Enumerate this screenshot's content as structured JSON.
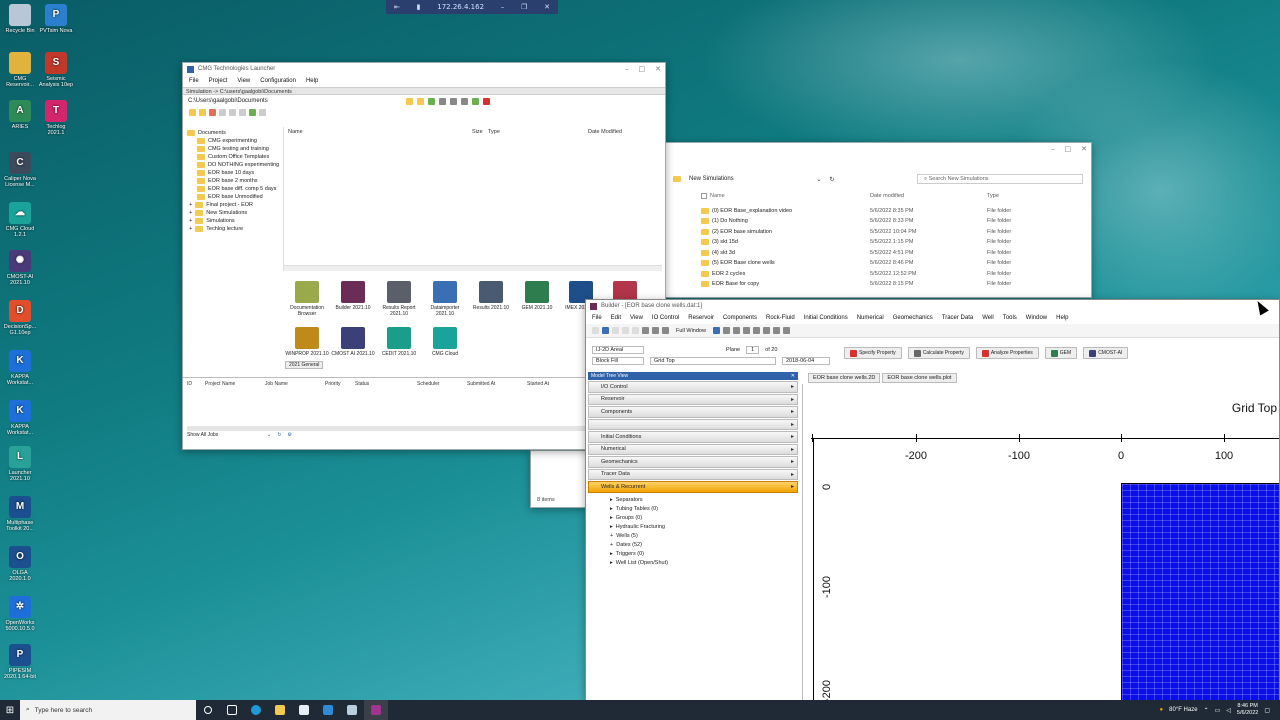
{
  "rdp_bar": {
    "ip": "172.26.4.162"
  },
  "desktop_icons": [
    {
      "label": "Recycle Bin",
      "color": "#b9c6d6"
    },
    {
      "label": "PVTsim Nova",
      "color": "#2c7fcf"
    },
    {
      "label": "CMG Reservoir...",
      "color": "#e2b33c"
    },
    {
      "label": "Seismic Analysis 10ep",
      "color": "#c0392b"
    },
    {
      "label": "ARIES",
      "color": "#2e8b57"
    },
    {
      "label": "Techlog 2021.1",
      "color": "#d3256b"
    },
    {
      "label": "Caliper Nova License M...",
      "color": "#3d4a5c"
    },
    {
      "label": "CMG Cloud 1.2.1",
      "color": "#1aa39a"
    },
    {
      "label": "CMOST-AI 2021.10",
      "color": "#4b3a7a"
    },
    {
      "label": "DecisionSp... G1.10ep",
      "color": "#e04e2b"
    },
    {
      "label": "KAPPA Workstat...",
      "color": "#1e6fd9"
    },
    {
      "label": "KAPPA Workstat...",
      "color": "#1e6fd9"
    },
    {
      "label": "Launcher 2021.10",
      "color": "#2aa198"
    },
    {
      "label": "Multiphase Toolkit 20...",
      "color": "#1b4f8f"
    },
    {
      "label": "OLGA 2020.1.0",
      "color": "#1b4f8f"
    },
    {
      "label": "OpenWorks 5000.10.5.0",
      "color": "#1e6fd9"
    },
    {
      "label": "PIPESIM 2020.1 64-bit",
      "color": "#1b4f8f"
    }
  ],
  "launcher": {
    "title": "CMG Technologies Launcher",
    "menu": [
      "File",
      "Project",
      "View",
      "Configuration",
      "Help"
    ],
    "simulation_path": "Simulation -> C:\\users\\gaalgobi\\Documents",
    "current_path": "C:\\Users\\gaalgobi\\Documents",
    "tree": [
      "Documents",
      "CMG experimenting",
      "CMG testing and training",
      "Custom Office Templates",
      "DO NOTHING experimenting",
      "EOR base 10 days",
      "EOR base 2 months",
      "EOR base diff. comp 5 days",
      "EOR base Unmodified",
      "Final project - EOR",
      "New Simulations",
      "Simulations",
      "Techlog lecture"
    ],
    "file_columns": [
      "Name",
      "Size",
      "Type",
      "Date Modified"
    ],
    "apps": [
      {
        "label": "Documentation Browser",
        "color": "#9aa94a"
      },
      {
        "label": "Builder 2021.10",
        "color": "#6b2d57"
      },
      {
        "label": "Results Report 2021.10",
        "color": "#5b5f6a"
      },
      {
        "label": "Dataimporter 2021.10",
        "color": "#3a6fb5"
      },
      {
        "label": "Results 2021.10",
        "color": "#4a5a70"
      },
      {
        "label": "GEM 2021.10",
        "color": "#2e7d4f"
      },
      {
        "label": "IMEX 2021.10",
        "color": "#1f4f8a"
      },
      {
        "label": "",
        "color": "#b2354a"
      },
      {
        "label": "WINPROP 2021.10",
        "color": "#c08a1a"
      },
      {
        "label": "CMOST AI 2021.10",
        "color": "#3b3f7a"
      },
      {
        "label": "CEDIT 2021.10",
        "color": "#1a9e8a"
      },
      {
        "label": "CMG Cloud",
        "color": "#1aa39a"
      }
    ],
    "apps_tab": "2021 General",
    "job_columns": [
      "ID",
      "Project Name",
      "Job Name",
      "Priority",
      "Status",
      "Scheduler",
      "Submitted At",
      "Started At"
    ],
    "jobs_filter": "Show All Jobs"
  },
  "explorer": {
    "breadcrumb": "New Simulations",
    "search_placeholder": "Search New Simulations",
    "columns": [
      "Name",
      "Date modified",
      "Type"
    ],
    "rows": [
      {
        "name": "(0) EOR Base_explanation video",
        "date": "5/6/2022 8:35 PM",
        "type": "File folder"
      },
      {
        "name": "(1) Do Nothing",
        "date": "5/6/2022 8:33 PM",
        "type": "File folder"
      },
      {
        "name": "(2) EOR base simulation",
        "date": "5/5/2022 10:04 PM",
        "type": "File folder"
      },
      {
        "name": "(3) skt 15d",
        "date": "5/5/2022 1:15 PM",
        "type": "File folder"
      },
      {
        "name": "(4) skt 3d",
        "date": "5/5/2022 4:51 PM",
        "type": "File folder"
      },
      {
        "name": "(5) EOR Base clone wells",
        "date": "5/6/2022 8:46 PM",
        "type": "File folder"
      },
      {
        "name": "EOR 2 cycles",
        "date": "5/5/2022 12:52 PM",
        "type": "File folder"
      },
      {
        "name": "EOR Base for copy",
        "date": "5/6/2022 8:15 PM",
        "type": "File folder"
      }
    ],
    "status": "8 items"
  },
  "builder": {
    "title": "Builder - [EOR base clone wells.dat:1]",
    "menu": [
      "File",
      "Edit",
      "View",
      "IO Control",
      "Reservoir",
      "Components",
      "Rock-Fluid",
      "Initial Conditions",
      "Numerical",
      "Geomechanics",
      "Tracer Data",
      "Well",
      "Tools",
      "Window",
      "Help"
    ],
    "full_window": "Full Window",
    "view_mode": "IJ-2D Areal",
    "plane_label": "Plane",
    "plane_value": "1",
    "plane_of": "of 20",
    "fill_mode": "Block Fill",
    "property": "Grid Top",
    "date": "2018-06-04",
    "buttons": [
      "Specify Property",
      "Calculate Property",
      "Analyze Properties",
      "GEM",
      "CMOST-AI"
    ],
    "model_tree_title": "Model Tree View",
    "sections": [
      "I/O Control",
      "Reservoir",
      "Components",
      "",
      "Initial Conditions",
      "Numerical",
      "Geomechanics",
      "Tracer Data",
      "Wells & Recurrent"
    ],
    "well_items": [
      "Separators",
      "Tubing Tables (0)",
      "Groups (0)",
      "Hydraulic Fracturing",
      "Wells (5)",
      "Dates (52)",
      "Triggers (0)",
      "Well List (Open/Shut)"
    ],
    "tabs": [
      "EOR base clone wells.2D",
      "EOR base clone wells.plot"
    ],
    "plot_title": "Grid Top",
    "x_ticks": [
      "-200",
      "-100",
      "0",
      "100"
    ],
    "y_ticks": [
      "0",
      "-100",
      "-200"
    ]
  },
  "taskbar": {
    "search_placeholder": "Type here to search",
    "weather": "80°F Haze",
    "time": "8:46 PM",
    "date": "5/6/2022"
  },
  "colors": {
    "grid_fill": "#0a0ee8",
    "active_section": "#f0a400",
    "taskbar": "#1f2a36"
  }
}
